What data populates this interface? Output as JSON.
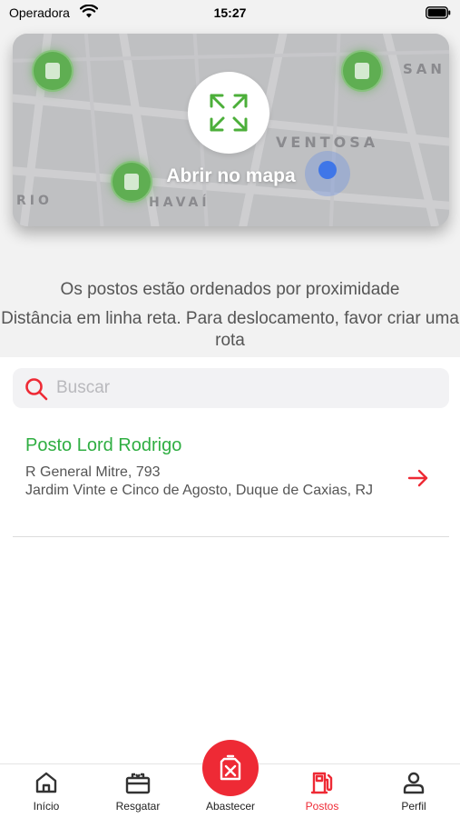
{
  "status_bar": {
    "carrier": "Operadora",
    "time": "15:27"
  },
  "map": {
    "caption": "Abrir no mapa",
    "street_labels": [
      "VENTOSA",
      "HAVAÍ",
      "RIO",
      "SAN"
    ],
    "pin_color": "#5fae52",
    "user_location_color": "#3f76e8",
    "expand_icon_color": "#4caf3a"
  },
  "info": {
    "line1": "Os postos estão ordenados por proximidade",
    "line2": "Distância em linha reta. Para deslocamento, favor criar uma rota"
  },
  "search": {
    "placeholder": "Buscar",
    "value": ""
  },
  "stations": [
    {
      "name": "Posto Lord Rodrigo",
      "address_line1": "R General Mitre, 793",
      "address_line2": "Jardim Vinte e Cinco de Agosto, Duque de Caxias, RJ"
    }
  ],
  "tabs": [
    {
      "label": "Início",
      "icon": "home-icon"
    },
    {
      "label": "Resgatar",
      "icon": "gift-icon"
    },
    {
      "label": "Abastecer",
      "icon": "fuel-can-icon"
    },
    {
      "label": "Postos",
      "icon": "gas-station-icon",
      "active": true
    },
    {
      "label": "Perfil",
      "icon": "user-icon"
    }
  ],
  "colors": {
    "accent": "#ee2a35",
    "station_name": "#2fae42"
  }
}
